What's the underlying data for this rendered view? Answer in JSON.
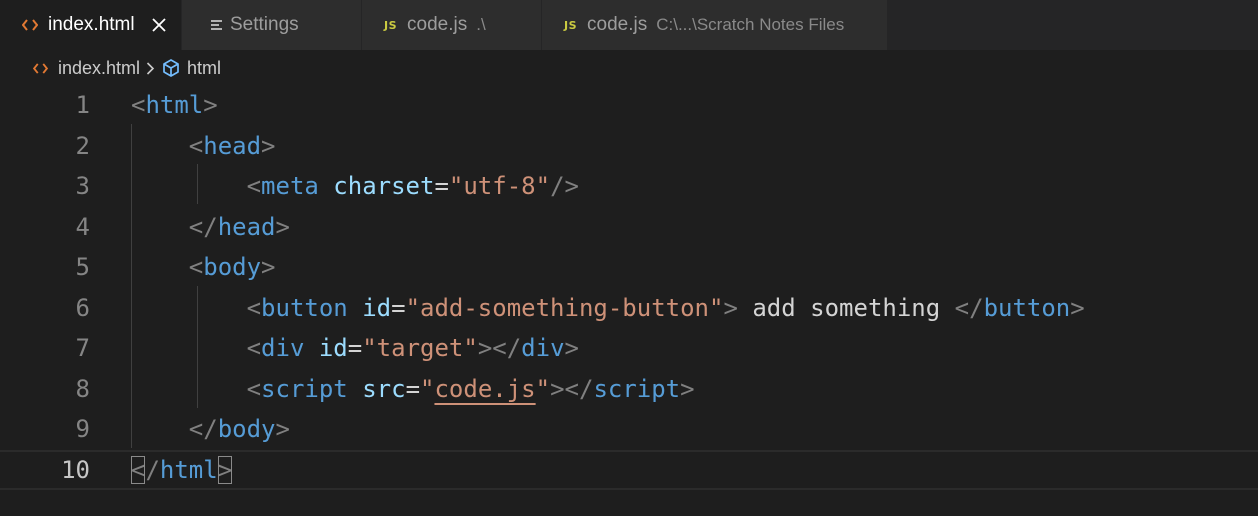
{
  "tabs": [
    {
      "label": "index.html",
      "icon": "html-code-icon",
      "active": true,
      "closable": true
    },
    {
      "label": "Settings",
      "icon": "settings-lines-icon",
      "active": false
    },
    {
      "label": "code.js",
      "description": ".\\",
      "icon": "js-file-icon",
      "badge": "JS",
      "active": false
    },
    {
      "label": "code.js",
      "description": "C:\\...\\Scratch Notes Files",
      "icon": "js-file-icon",
      "badge": "JS",
      "active": false
    }
  ],
  "breadcrumb": {
    "file": "index.html",
    "symbol": "html"
  },
  "editor": {
    "current_line": 10,
    "lines": [
      {
        "n": "1",
        "tokens": [
          [
            "p",
            "<"
          ],
          [
            "t",
            "html"
          ],
          [
            "p",
            ">"
          ]
        ]
      },
      {
        "n": "2",
        "tokens": [
          [
            "x",
            "    "
          ],
          [
            "p",
            "<"
          ],
          [
            "t",
            "head"
          ],
          [
            "p",
            ">"
          ]
        ]
      },
      {
        "n": "3",
        "tokens": [
          [
            "x",
            "        "
          ],
          [
            "p",
            "<"
          ],
          [
            "t",
            "meta"
          ],
          [
            "x",
            " "
          ],
          [
            "a",
            "charset"
          ],
          [
            "x",
            "="
          ],
          [
            "s",
            "\"utf-8\""
          ],
          [
            "p",
            "/>"
          ]
        ]
      },
      {
        "n": "4",
        "tokens": [
          [
            "x",
            "    "
          ],
          [
            "p",
            "</"
          ],
          [
            "t",
            "head"
          ],
          [
            "p",
            ">"
          ]
        ]
      },
      {
        "n": "5",
        "tokens": [
          [
            "x",
            "    "
          ],
          [
            "p",
            "<"
          ],
          [
            "t",
            "body"
          ],
          [
            "p",
            ">"
          ]
        ]
      },
      {
        "n": "6",
        "tokens": [
          [
            "x",
            "        "
          ],
          [
            "p",
            "<"
          ],
          [
            "t",
            "button"
          ],
          [
            "x",
            " "
          ],
          [
            "a",
            "id"
          ],
          [
            "x",
            "="
          ],
          [
            "s",
            "\"add-something-button\""
          ],
          [
            "p",
            ">"
          ],
          [
            "x",
            " add something "
          ],
          [
            "p",
            "</"
          ],
          [
            "t",
            "button"
          ],
          [
            "p",
            ">"
          ]
        ]
      },
      {
        "n": "7",
        "tokens": [
          [
            "x",
            "        "
          ],
          [
            "p",
            "<"
          ],
          [
            "t",
            "div"
          ],
          [
            "x",
            " "
          ],
          [
            "a",
            "id"
          ],
          [
            "x",
            "="
          ],
          [
            "s",
            "\"target\""
          ],
          [
            "p",
            "></"
          ],
          [
            "t",
            "div"
          ],
          [
            "p",
            ">"
          ]
        ]
      },
      {
        "n": "8",
        "tokens": [
          [
            "x",
            "        "
          ],
          [
            "p",
            "<"
          ],
          [
            "t",
            "script"
          ],
          [
            "x",
            " "
          ],
          [
            "a",
            "src"
          ],
          [
            "x",
            "="
          ],
          [
            "s",
            "\""
          ],
          [
            "su",
            "code.js"
          ],
          [
            "s",
            "\""
          ],
          [
            "p",
            "></"
          ],
          [
            "t",
            "script"
          ],
          [
            "p",
            ">"
          ]
        ]
      },
      {
        "n": "9",
        "tokens": [
          [
            "x",
            "    "
          ],
          [
            "p",
            "</"
          ],
          [
            "t",
            "body"
          ],
          [
            "p",
            ">"
          ]
        ]
      },
      {
        "n": "10",
        "tokens": [
          [
            "pb",
            "<"
          ],
          [
            "p",
            "/"
          ],
          [
            "t",
            "html"
          ],
          [
            "pb",
            ">"
          ]
        ]
      }
    ]
  },
  "colors": {
    "background": "#1e1e1e",
    "tab_inactive": "#2d2d2d",
    "html_icon": "#e37933",
    "js_badge": "#cbcb41",
    "symbol_icon": "#75beff",
    "tag": "#569cd6",
    "attribute": "#9cdcfe",
    "string": "#ce9178",
    "punctuation": "#808080"
  }
}
